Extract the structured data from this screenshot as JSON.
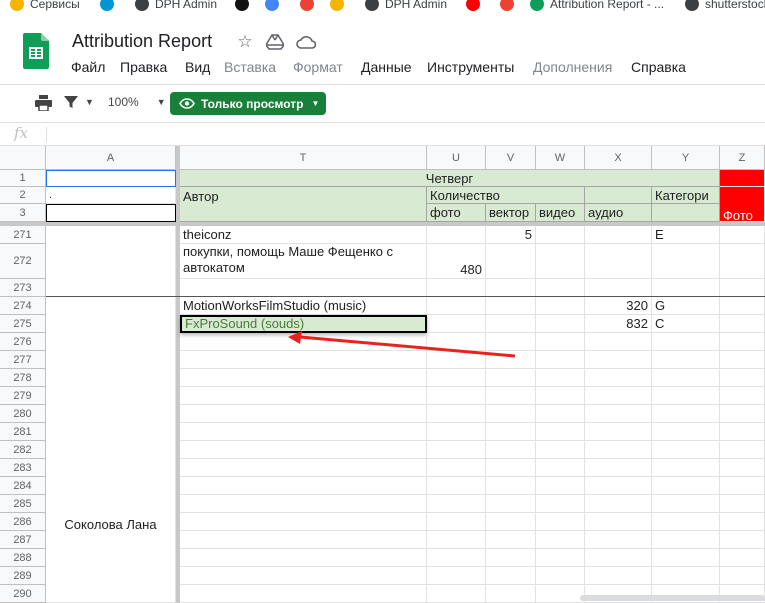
{
  "bookmarks": [
    {
      "label": "Сервисы",
      "color": "#f4b400"
    },
    {
      "label": "",
      "color": "#0096d6"
    },
    {
      "label": "DPH Admin",
      "color": "#3c4043"
    },
    {
      "label": "",
      "color": "#111111"
    },
    {
      "label": "",
      "color": "#4285f4"
    },
    {
      "label": "",
      "color": "#ea4335"
    },
    {
      "label": "",
      "color": "#f4b400"
    },
    {
      "label": "DPH Admin",
      "color": "#3c4043"
    },
    {
      "label": "",
      "color": "#ff0000"
    },
    {
      "label": "",
      "color": "#ea4335"
    },
    {
      "label": "Attribution Report - ...",
      "color": "#0f9d58"
    },
    {
      "label": "shutterstock",
      "color": "#3c4043"
    }
  ],
  "document": {
    "title": "Attribution Report"
  },
  "menu": [
    {
      "label": "Файл",
      "disabled": false
    },
    {
      "label": "Правка",
      "disabled": false
    },
    {
      "label": "Вид",
      "disabled": false
    },
    {
      "label": "Вставка",
      "disabled": true
    },
    {
      "label": "Формат",
      "disabled": true
    },
    {
      "label": "Данные",
      "disabled": false
    },
    {
      "label": "Инструменты",
      "disabled": false
    },
    {
      "label": "Дополнения",
      "disabled": true
    },
    {
      "label": "Справка",
      "disabled": false
    }
  ],
  "toolbar": {
    "zoom": "100%",
    "view_only_label": "Только просмотр"
  },
  "formula_bar": {
    "fx": "fx",
    "value": ""
  },
  "columns": [
    "A",
    "T",
    "U",
    "V",
    "W",
    "X",
    "Y",
    "Z"
  ],
  "frozen_rows": [
    "1",
    "2",
    "3"
  ],
  "header": {
    "day": "Четверг",
    "author": "Автор",
    "quantity": "Количество",
    "category": "Категори",
    "a2": ".",
    "photo": "фото",
    "vector": "вектор",
    "video": "видео",
    "audio": "аудио",
    "z_photo": "Фото"
  },
  "rows": [
    {
      "num": "271",
      "author": "theiconz",
      "photo": "",
      "vector": "5",
      "video": "",
      "audio": "",
      "category": "E"
    },
    {
      "num": "272",
      "author": "покупки, помощь Маше Фещенко с",
      "author2": "автокатом",
      "photo": "480",
      "vector": "",
      "video": "",
      "audio": "",
      "category": ""
    },
    {
      "num": "273",
      "author": "",
      "photo": "",
      "vector": "",
      "video": "",
      "audio": "",
      "category": ""
    },
    {
      "num": "274",
      "author": "MotionWorksFilmStudio (music)",
      "photo": "",
      "vector": "",
      "video": "",
      "audio": "320",
      "category": "G"
    },
    {
      "num": "275",
      "author": "FxProSound (souds)",
      "photo": "",
      "vector": "",
      "video": "",
      "audio": "832",
      "category": "C"
    },
    {
      "num": "276"
    },
    {
      "num": "277"
    },
    {
      "num": "278"
    },
    {
      "num": "279"
    },
    {
      "num": "280"
    },
    {
      "num": "281"
    },
    {
      "num": "282"
    },
    {
      "num": "283"
    },
    {
      "num": "284"
    },
    {
      "num": "285"
    },
    {
      "num": "286"
    },
    {
      "num": "287"
    },
    {
      "num": "288"
    },
    {
      "num": "289"
    },
    {
      "num": "290"
    }
  ],
  "merged_a_value": "Соколова Лана",
  "colors": {
    "accent_green": "#188038",
    "header_green": "#d9ead3",
    "annotation_red": "#e8231e"
  }
}
